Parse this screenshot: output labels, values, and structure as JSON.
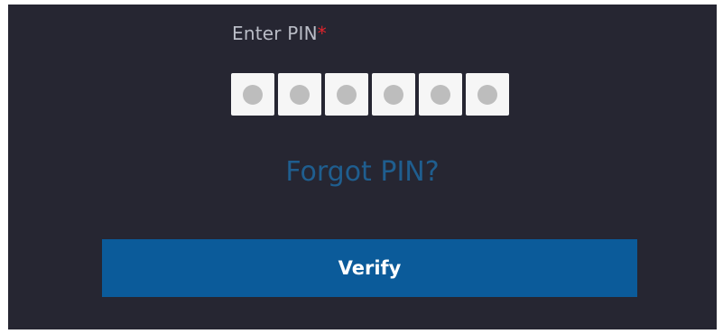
{
  "pin_form": {
    "label": "Enter PIN",
    "required_marker": "*",
    "pin_length": 6,
    "entered_digits": 0,
    "forgot_link": "Forgot PIN?",
    "verify_button": "Verify"
  },
  "colors": {
    "panel_background": "#262632",
    "label_text": "#b9bcc6",
    "required_marker": "#e0242c",
    "pin_box": "#f6f6f6",
    "pin_dot": "#bdbdbd",
    "link": "#1f5e8f",
    "button": "#0b5b9a",
    "button_text": "#ffffff"
  }
}
